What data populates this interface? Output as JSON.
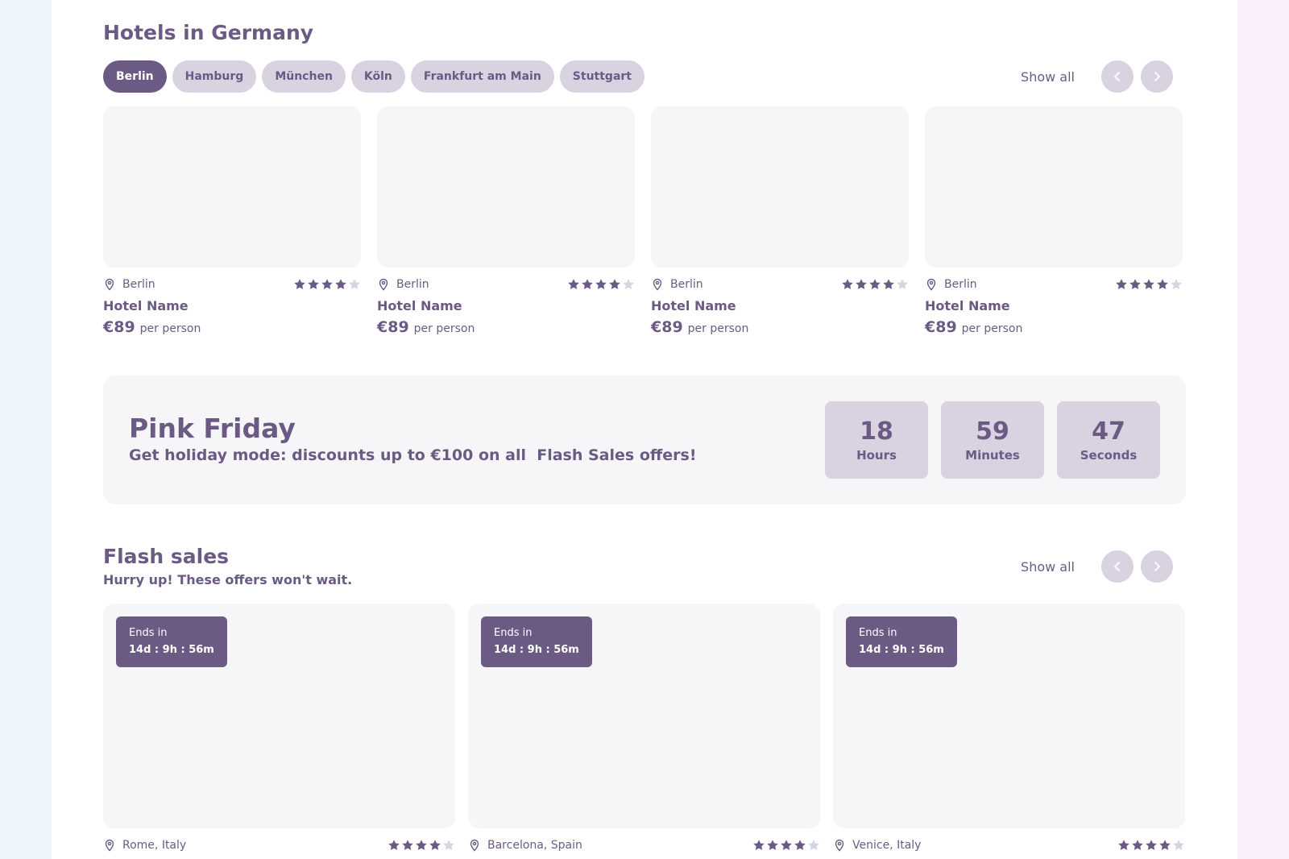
{
  "hotels": {
    "title": "Hotels in Germany",
    "show_all": "Show all",
    "cities": [
      "Berlin",
      "Hamburg",
      "München",
      "Köln",
      "Frankfurt am Main",
      "Stuttgart"
    ],
    "cards": [
      {
        "location": "Berlin",
        "name": "Hotel Name",
        "price": "€89",
        "per": "per person",
        "rating": 4
      },
      {
        "location": "Berlin",
        "name": "Hotel Name",
        "price": "€89",
        "per": "per person",
        "rating": 4
      },
      {
        "location": "Berlin",
        "name": "Hotel Name",
        "price": "€89",
        "per": "per person",
        "rating": 4
      },
      {
        "location": "Berlin",
        "name": "Hotel Name",
        "price": "€89",
        "per": "per person",
        "rating": 4
      }
    ]
  },
  "promo": {
    "title": "Pink Friday",
    "subtitle": "Get holiday mode: discounts up to €100 on all  Flash Sales offers!",
    "countdown": [
      {
        "value": "18",
        "label": "Hours"
      },
      {
        "value": "59",
        "label": "Minutes"
      },
      {
        "value": "47",
        "label": "Seconds"
      }
    ]
  },
  "flash": {
    "title": "Flash sales",
    "subtitle": "Hurry up! These offers won't wait.",
    "show_all": "Show all",
    "cards": [
      {
        "ends_label": "Ends in",
        "ends_time": "14d : 9h : 56m",
        "location": "Rome, Italy",
        "rating": 4
      },
      {
        "ends_label": "Ends in",
        "ends_time": "14d : 9h : 56m",
        "location": "Barcelona, Spain",
        "rating": 4
      },
      {
        "ends_label": "Ends in",
        "ends_time": "14d : 9h : 56m",
        "location": "Venice, Italy",
        "rating": 4
      }
    ]
  },
  "colors": {
    "primary": "#6b5b84",
    "chip": "#d8d2e1",
    "card_bg": "#f6f6f8",
    "star_empty": "#d8d2e1"
  },
  "icons": [
    "location-pin-icon",
    "star-icon",
    "chevron-left-icon",
    "chevron-right-icon"
  ]
}
